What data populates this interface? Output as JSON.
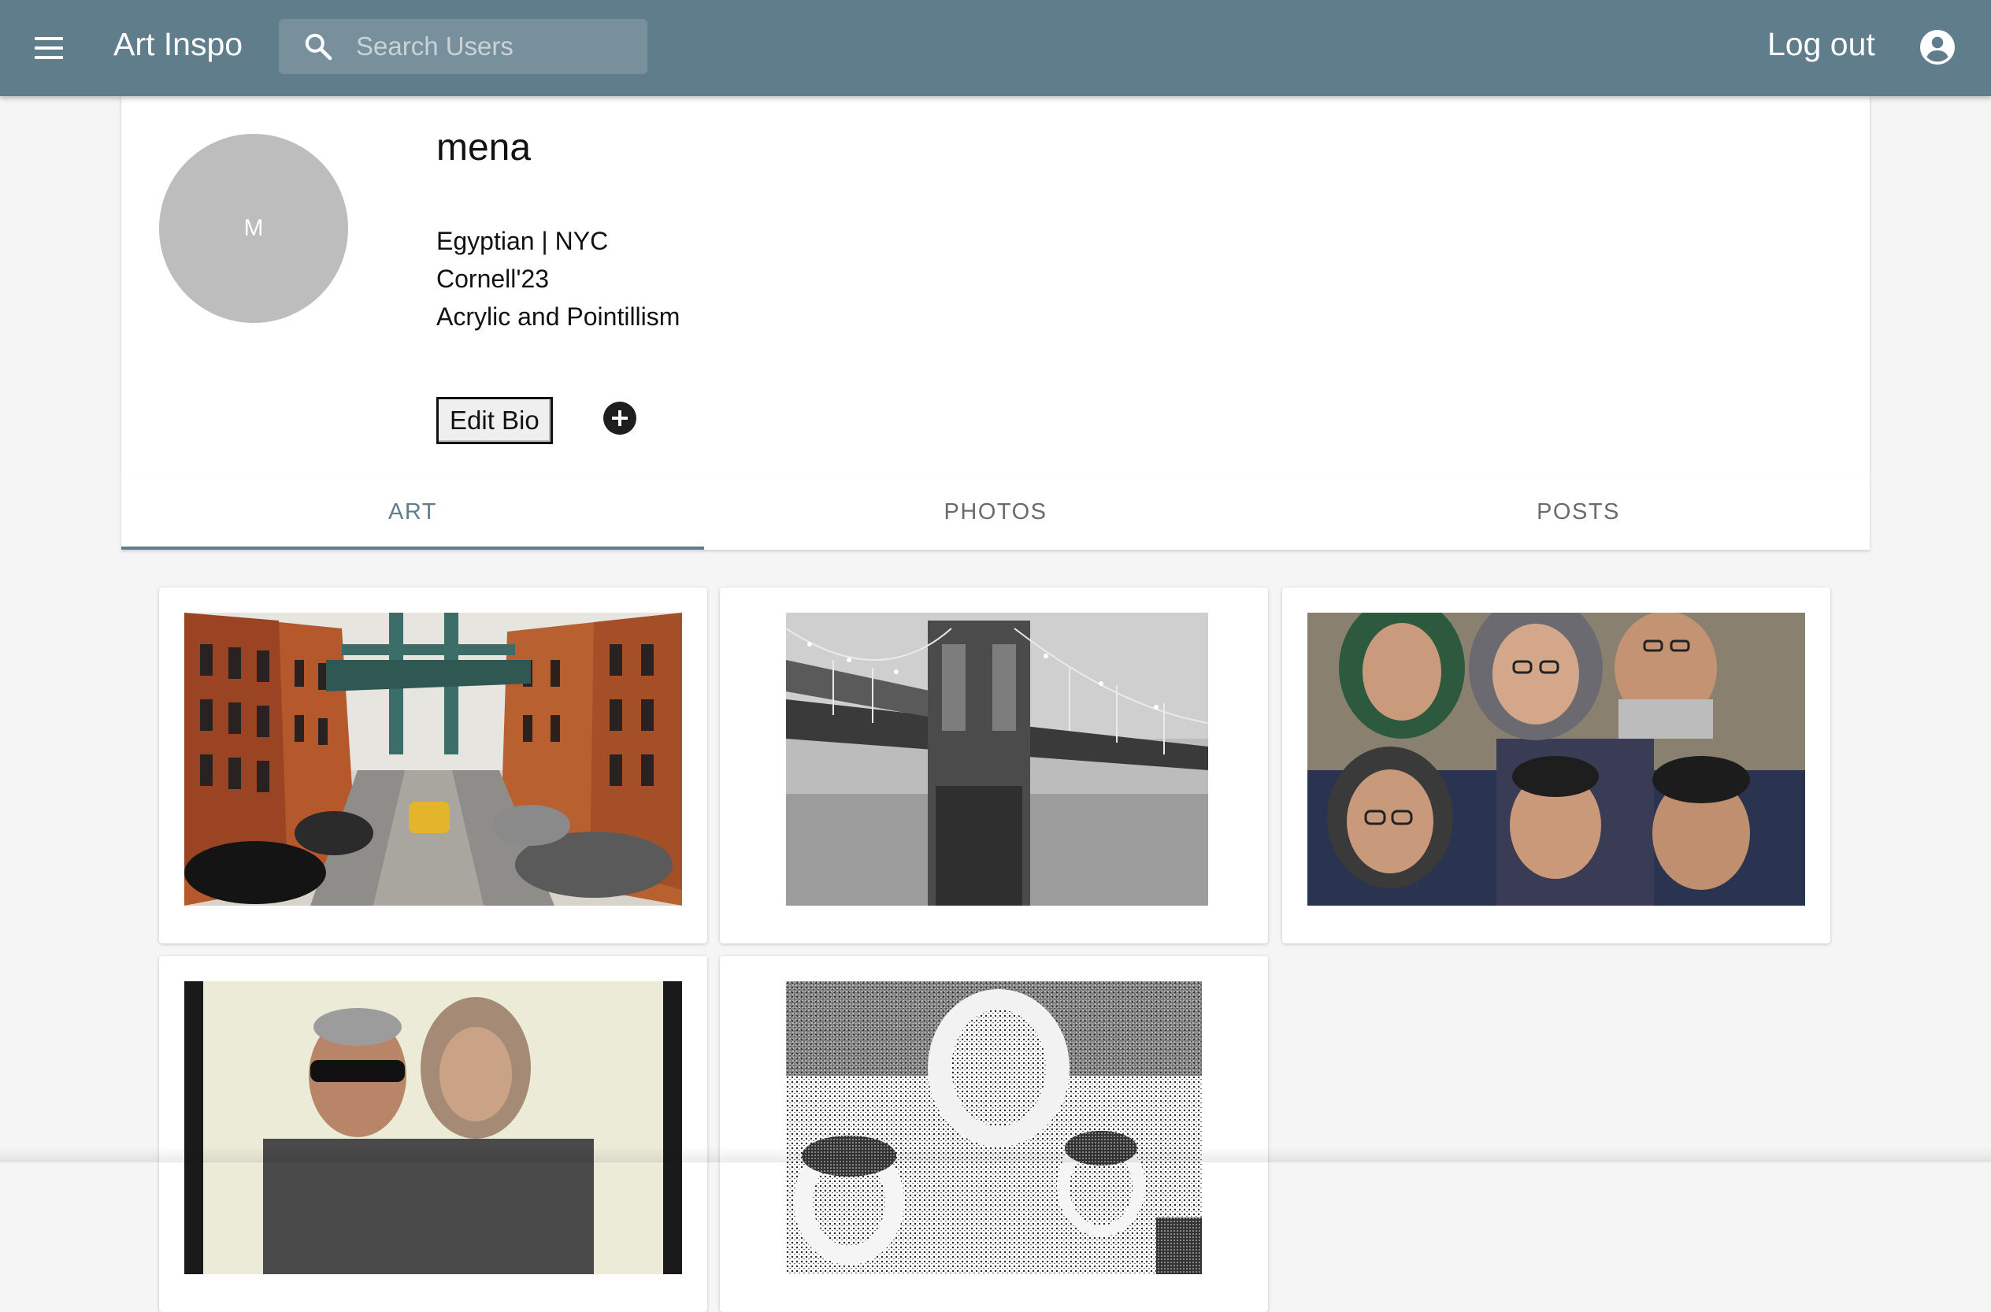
{
  "app": {
    "title": "Art Inspo",
    "accent_color": "#607d8b"
  },
  "search": {
    "placeholder": "Search Users",
    "value": ""
  },
  "header": {
    "logout_label": "Log out",
    "menu_icon": "menu-icon",
    "search_icon": "search-icon",
    "account_icon": "account-circle-icon"
  },
  "profile": {
    "avatar_initial": "M",
    "username": "mena",
    "bio_lines": [
      "Egyptian | NYC",
      "Cornell'23",
      "Acrylic and Pointillism"
    ],
    "edit_bio_label": "Edit Bio",
    "add_icon": "add-circle-icon"
  },
  "tabs": [
    {
      "label": "ART",
      "active": true
    },
    {
      "label": "PHOTOS",
      "active": false
    },
    {
      "label": "POSTS",
      "active": false
    }
  ],
  "artworks": [
    {
      "name": "manhattan-bridge-street-painting",
      "description_icon": "painting"
    },
    {
      "name": "brooklyn-bridge-grayscale-painting",
      "description_icon": "painting"
    },
    {
      "name": "family-portrait-six-faces-painting",
      "description_icon": "painting"
    },
    {
      "name": "couple-portrait-painting",
      "description_icon": "painting"
    },
    {
      "name": "family-pointillism-drawing",
      "description_icon": "drawing"
    }
  ]
}
